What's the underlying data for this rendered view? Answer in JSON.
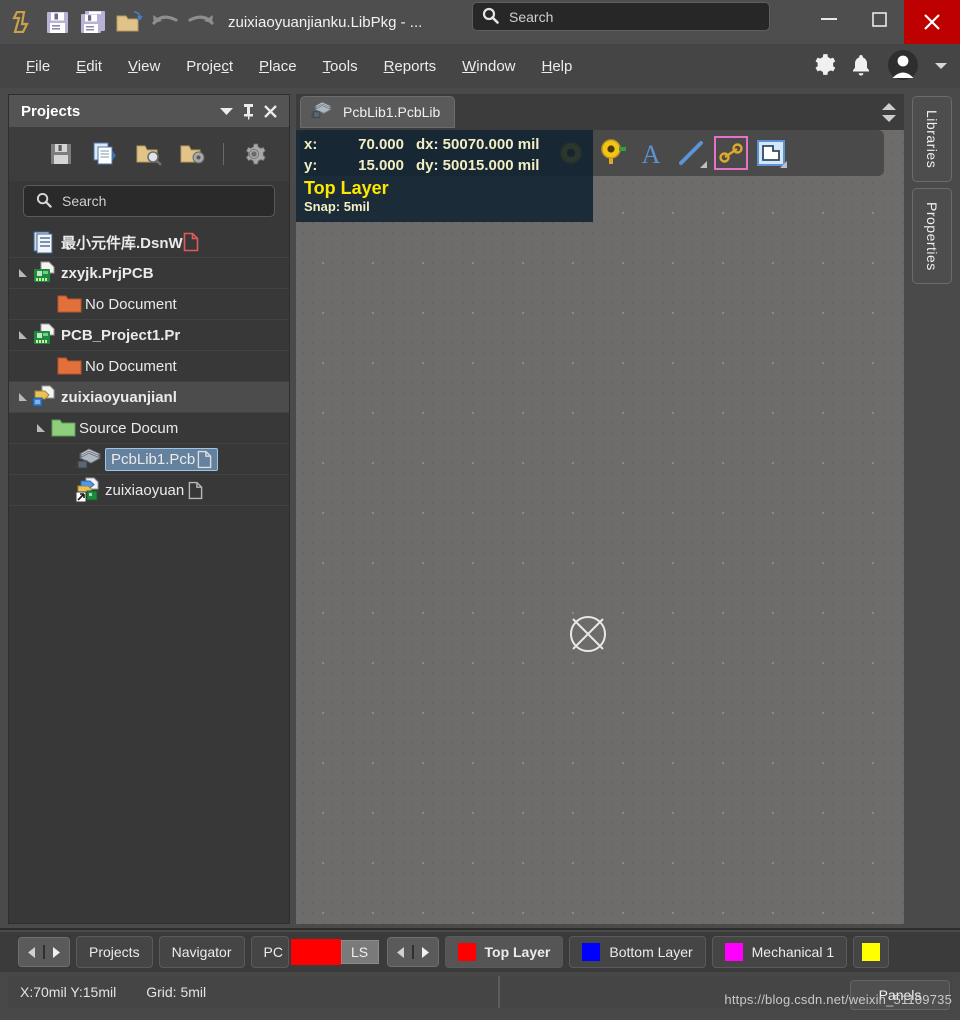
{
  "titlebar": {
    "title": "zuixiaoyuanjianku.LibPkg - ...",
    "icons": [
      "altium-logo-icon",
      "save-icon",
      "save-all-icon",
      "open-folder-icon",
      "undo-icon",
      "redo-icon"
    ],
    "search_placeholder": "Search",
    "minimize_label": "—",
    "maximize_label": "□",
    "close_label": "✕"
  },
  "menubar": {
    "items": [
      {
        "pre": "",
        "hot": "F",
        "post": "ile"
      },
      {
        "pre": "",
        "hot": "E",
        "post": "dit"
      },
      {
        "pre": "",
        "hot": "V",
        "post": "iew"
      },
      {
        "pre": "Proje",
        "hot": "c",
        "post": "t"
      },
      {
        "pre": "",
        "hot": "P",
        "post": "lace"
      },
      {
        "pre": "",
        "hot": "T",
        "post": "ools"
      },
      {
        "pre": "",
        "hot": "R",
        "post": "eports"
      },
      {
        "pre": "",
        "hot": "W",
        "post": "indow"
      },
      {
        "pre": "",
        "hot": "H",
        "post": "elp"
      }
    ],
    "right_icons": [
      "gear-icon",
      "bell-icon",
      "user-avatar-icon",
      "chevron-down-icon"
    ]
  },
  "projects_panel": {
    "title": "Projects",
    "header_buttons": [
      "collapse-chevron-icon",
      "pin-icon",
      "close-icon"
    ],
    "toolbar_icons": [
      "save-icon",
      "copy-documents-icon",
      "open-project-search-icon",
      "project-options-icon",
      "settings-gear-icon"
    ],
    "search_placeholder": "Search",
    "tree": [
      {
        "label": "最小元件库.DsnW",
        "icon": "workspace-icon",
        "indent": 0,
        "twisty": "none",
        "bold": true,
        "doc_glyph": "red",
        "selected": false
      },
      {
        "label": "zxyjk.PrjPCB",
        "icon": "pcb-project-icon",
        "indent": 0,
        "twisty": "open",
        "bold": true,
        "doc_glyph": "none",
        "selected": false
      },
      {
        "label": "No Document",
        "icon": "orange-folder-icon",
        "indent": 1,
        "twisty": "none",
        "bold": false,
        "doc_glyph": "none",
        "selected": false
      },
      {
        "label": "PCB_Project1.Pr",
        "icon": "pcb-project-icon",
        "indent": 0,
        "twisty": "open",
        "bold": true,
        "doc_glyph": "none",
        "selected": false
      },
      {
        "label": "No Document",
        "icon": "orange-folder-icon",
        "indent": 1,
        "twisty": "none",
        "bold": false,
        "doc_glyph": "none",
        "selected": false
      },
      {
        "label": "zuixiaoyuanjianl",
        "icon": "libpkg-icon",
        "indent": 0,
        "twisty": "open",
        "bold": true,
        "doc_glyph": "none",
        "selected": false,
        "row_highlight": true
      },
      {
        "label": "Source Docum",
        "icon": "green-folder-icon",
        "indent": 1,
        "twisty": "open",
        "bold": false,
        "doc_glyph": "none",
        "selected": false
      },
      {
        "label": "PcbLib1.Pcb",
        "icon": "pcblib-icon",
        "indent": 2,
        "twisty": "none",
        "bold": false,
        "doc_glyph": "grey",
        "selected": true
      },
      {
        "label": "zuixiaoyuan",
        "icon": "schlib-icon",
        "indent": 2,
        "twisty": "none",
        "bold": false,
        "doc_glyph": "grey",
        "selected": false
      }
    ]
  },
  "editor": {
    "tab_label": "PcbLib1.PcbLib",
    "tab_icon": "pcblib-icon",
    "toolbar_icons": [
      "pad-icon",
      "via-icon",
      "string-icon",
      "line-icon",
      "track-icon",
      "board-region-icon"
    ],
    "coordinates": {
      "x_key": "x:",
      "x_value": "70.000",
      "dx_label": "dx: 50070.000 mil",
      "y_key": "y:",
      "y_value": "15.000",
      "dy_label": "dy: 50015.000 mil",
      "layer": "Top Layer",
      "snap": "Snap: 5mil"
    }
  },
  "right_tabs": [
    {
      "label": "Libraries"
    },
    {
      "label": "Properties"
    }
  ],
  "bottom_bar": {
    "nav_left_icon": "arrow-left-icon",
    "nav_right_icon": "arrow-right-icon",
    "panel_tabs": [
      {
        "label": "Projects"
      },
      {
        "label": "Navigator"
      },
      {
        "label": "PC"
      }
    ],
    "ls_label": "LS",
    "ls_color": "#ff0000",
    "layer_tabs": [
      {
        "label": "Top Layer",
        "color": "#ff0000",
        "active": true
      },
      {
        "label": "Bottom Layer",
        "color": "#0000ff",
        "active": false
      },
      {
        "label": "Mechanical 1",
        "color": "#ff00ff",
        "active": false
      },
      {
        "label": "",
        "color": "#ffff00",
        "active": false
      }
    ]
  },
  "statusbar": {
    "coords": "X:70mil Y:15mil",
    "grid": "Grid: 5mil",
    "panels_label": "Panels",
    "watermark": "https://blog.csdn.net/weixin_51109735"
  },
  "colors": {
    "accent_red": "#bd0000",
    "selection_blue": "#64829e",
    "canvas_bg": "#6e6b6b",
    "overlay_bg": "#102230",
    "layer_yellow": "#ffe800"
  }
}
